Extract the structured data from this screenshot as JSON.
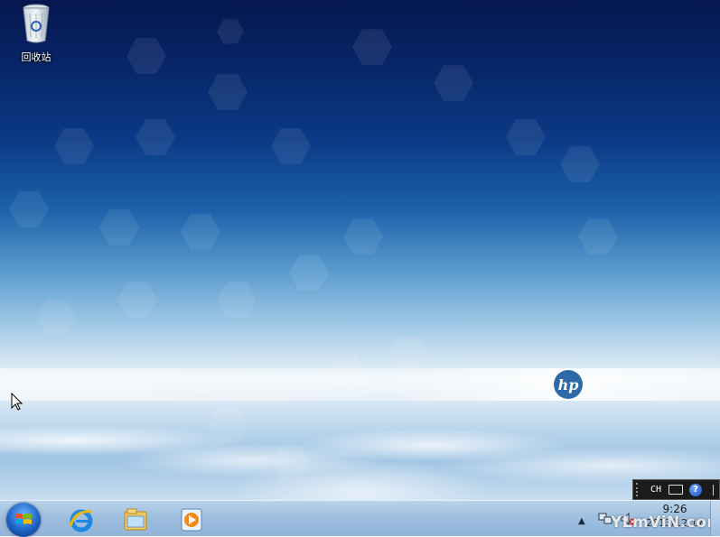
{
  "desktop": {
    "icons": [
      {
        "label": "回收站",
        "icon": "recycle-bin-icon"
      }
    ],
    "wallpaper_brand": "hp"
  },
  "ime_bar": {
    "language": "CH",
    "icons": [
      "keyboard-icon",
      "help-icon",
      "options-icon"
    ]
  },
  "taskbar": {
    "start_icon": "windows-logo-icon",
    "pinned": [
      {
        "name": "Internet Explorer",
        "icon": "internet-explorer-icon"
      },
      {
        "name": "Windows Explorer",
        "icon": "folder-icon"
      },
      {
        "name": "Windows Media Player",
        "icon": "media-player-icon"
      }
    ],
    "tray": {
      "time": "9:26",
      "date": "2013/12/17",
      "icons": [
        "show-hidden-icons-icon",
        "network-icon",
        "volume-muted-icon"
      ]
    }
  },
  "watermark": "YLmViN.com",
  "colors": {
    "sky_top": "#05184f",
    "taskbar": "#9fbfdf"
  }
}
